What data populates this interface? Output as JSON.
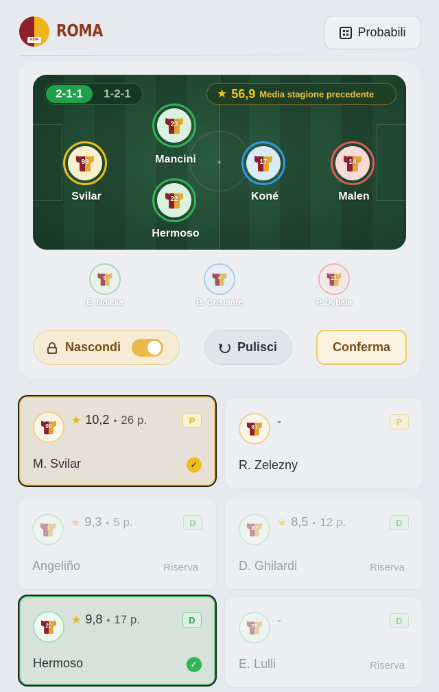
{
  "header": {
    "team_name": "ROMA",
    "crest_text": "ROM",
    "probabili_label": "Probabili"
  },
  "lineup": {
    "formations": [
      {
        "label": "2-1-1",
        "active": true
      },
      {
        "label": "1-2-1",
        "active": false
      }
    ],
    "average": {
      "value": "56,9",
      "label": "Media stagione precedente"
    },
    "players": [
      {
        "name": "Svilar",
        "number": "99",
        "role_color": "#f2bd1d"
      },
      {
        "name": "Mancini",
        "number": "23",
        "role_color": "#2fb457"
      },
      {
        "name": "Hermoso",
        "number": "22",
        "role_color": "#2fb457"
      },
      {
        "name": "Koné",
        "number": "17",
        "role_color": "#2f9ae0"
      },
      {
        "name": "Malen",
        "number": "14",
        "role_color": "#e35a5a"
      }
    ],
    "bench": [
      {
        "name": "E. Ndicka",
        "number": "5",
        "role_color": "#2fb457"
      },
      {
        "name": "B. Cristante",
        "number": "4",
        "role_color": "#2f9ae0"
      },
      {
        "name": "P. Dybala",
        "number": "21",
        "role_color": "#e35a5a"
      }
    ],
    "buttons": {
      "nascondi": "Nascondi",
      "pulisci": "Pulisci",
      "conferma": "Conferma"
    }
  },
  "cards": [
    {
      "name": "M. Svilar",
      "number": "99",
      "rating": "10,2",
      "presences": "26 p.",
      "role": "P",
      "selected": "gold",
      "reserve": ""
    },
    {
      "name": "R. Zelezny",
      "number": "91",
      "rating": "-",
      "presences": "",
      "role": "P",
      "selected": "",
      "reserve": ""
    },
    {
      "name": "Angeliño",
      "number": "3",
      "rating": "9,3",
      "presences": "5 p.",
      "role": "D",
      "selected": "",
      "reserve": "Riserva"
    },
    {
      "name": "D. Ghilardi",
      "number": "87",
      "rating": "8,5",
      "presences": "12 p.",
      "role": "D",
      "selected": "",
      "reserve": "Riserva"
    },
    {
      "name": "Hermoso",
      "number": "22",
      "rating": "9,8",
      "presences": "17 p.",
      "role": "D",
      "selected": "green",
      "reserve": ""
    },
    {
      "name": "E. Lulli",
      "number": "79",
      "rating": "-",
      "presences": "",
      "role": "D",
      "selected": "",
      "reserve": "Riserva"
    }
  ]
}
